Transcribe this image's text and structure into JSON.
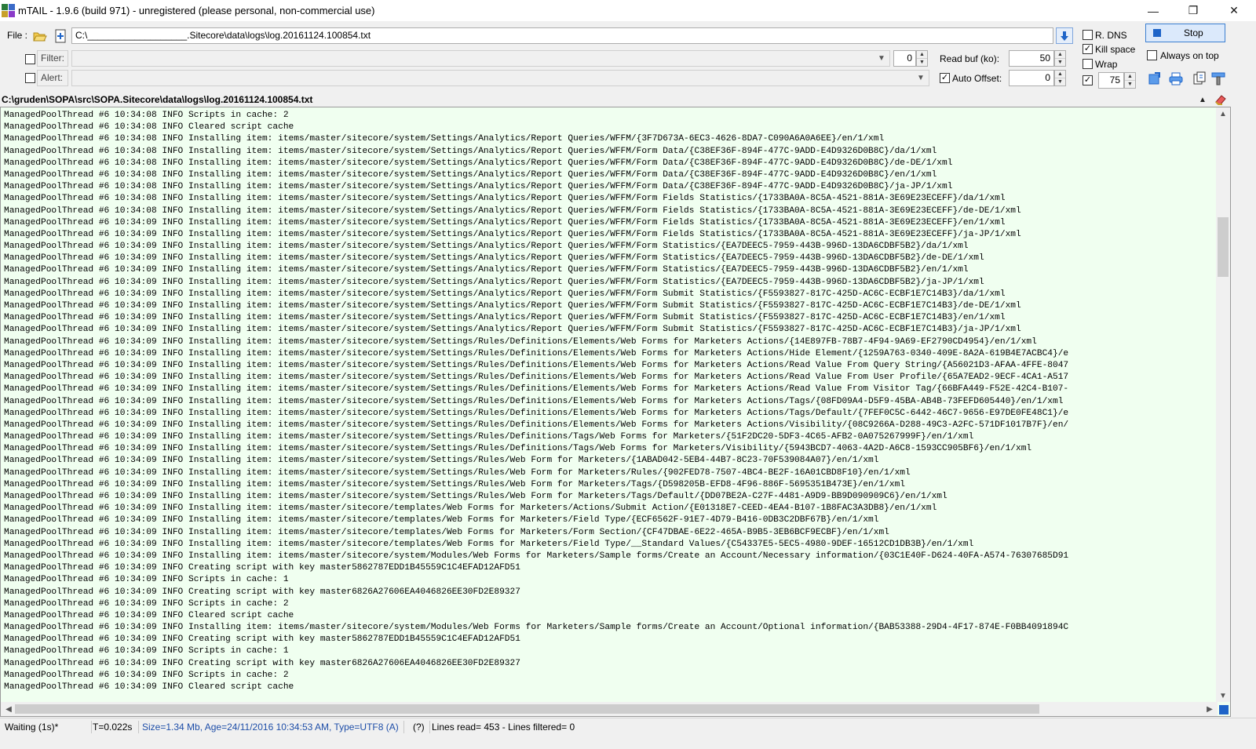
{
  "window": {
    "title": "mTAIL - 1.9.6 (build 971) - unregistered (please personal, non-commercial use)",
    "controls": [
      "—",
      "❐",
      "✕"
    ]
  },
  "toolbar": {
    "file_label": "File :",
    "file_path": "C:\\___________________.Sitecore\\data\\logs\\log.20161124.100854.txt",
    "filter_label": "Filter:",
    "filter_value": "",
    "filter_spin": "0",
    "alert_label": "Alert:",
    "alert_value": "",
    "read_buf_label": "Read buf (ko):",
    "read_buf_value": "50",
    "auto_offset_label": "Auto Offset:",
    "auto_offset_value": "0",
    "auto_offset_checked": true,
    "option_r_dns": "R. DNS",
    "option_kill_space": "Kill space",
    "option_wrap": "Wrap",
    "spin_75_value": "75",
    "stop_label": "Stop",
    "always_on_top": "Always on top",
    "icons": [
      "open-folder-icon",
      "add-file-icon",
      "download-arrow-icon",
      "export-icon",
      "print-icon",
      "copy-icon",
      "tools-icon",
      "collapse-icon",
      "eraser-icon"
    ]
  },
  "log": {
    "path": "C:\\gruden\\SOPA\\src\\SOPA.Sitecore\\data\\logs\\log.20161124.100854.txt",
    "lines": [
      "ManagedPoolThread #6 10:34:08 INFO Scripts in cache: 2",
      "ManagedPoolThread #6 10:34:08 INFO Cleared script cache",
      "ManagedPoolThread #6 10:34:08 INFO Installing item: items/master/sitecore/system/Settings/Analytics/Report Queries/WFFM/{3F7D673A-6EC3-4626-8DA7-C090A6A0A6EE}/en/1/xml",
      "ManagedPoolThread #6 10:34:08 INFO Installing item: items/master/sitecore/system/Settings/Analytics/Report Queries/WFFM/Form Data/{C38EF36F-894F-477C-9ADD-E4D9326D0B8C}/da/1/xml",
      "ManagedPoolThread #6 10:34:08 INFO Installing item: items/master/sitecore/system/Settings/Analytics/Report Queries/WFFM/Form Data/{C38EF36F-894F-477C-9ADD-E4D9326D0B8C}/de-DE/1/xml",
      "ManagedPoolThread #6 10:34:08 INFO Installing item: items/master/sitecore/system/Settings/Analytics/Report Queries/WFFM/Form Data/{C38EF36F-894F-477C-9ADD-E4D9326D0B8C}/en/1/xml",
      "ManagedPoolThread #6 10:34:08 INFO Installing item: items/master/sitecore/system/Settings/Analytics/Report Queries/WFFM/Form Data/{C38EF36F-894F-477C-9ADD-E4D9326D0B8C}/ja-JP/1/xml",
      "ManagedPoolThread #6 10:34:08 INFO Installing item: items/master/sitecore/system/Settings/Analytics/Report Queries/WFFM/Form Fields Statistics/{1733BA0A-8C5A-4521-881A-3E69E23ECEFF}/da/1/xml",
      "ManagedPoolThread #6 10:34:08 INFO Installing item: items/master/sitecore/system/Settings/Analytics/Report Queries/WFFM/Form Fields Statistics/{1733BA0A-8C5A-4521-881A-3E69E23ECEFF}/de-DE/1/xml",
      "ManagedPoolThread #6 10:34:09 INFO Installing item: items/master/sitecore/system/Settings/Analytics/Report Queries/WFFM/Form Fields Statistics/{1733BA0A-8C5A-4521-881A-3E69E23ECEFF}/en/1/xml",
      "ManagedPoolThread #6 10:34:09 INFO Installing item: items/master/sitecore/system/Settings/Analytics/Report Queries/WFFM/Form Fields Statistics/{1733BA0A-8C5A-4521-881A-3E69E23ECEFF}/ja-JP/1/xml",
      "ManagedPoolThread #6 10:34:09 INFO Installing item: items/master/sitecore/system/Settings/Analytics/Report Queries/WFFM/Form Statistics/{EA7DEEC5-7959-443B-996D-13DA6CDBF5B2}/da/1/xml",
      "ManagedPoolThread #6 10:34:09 INFO Installing item: items/master/sitecore/system/Settings/Analytics/Report Queries/WFFM/Form Statistics/{EA7DEEC5-7959-443B-996D-13DA6CDBF5B2}/de-DE/1/xml",
      "ManagedPoolThread #6 10:34:09 INFO Installing item: items/master/sitecore/system/Settings/Analytics/Report Queries/WFFM/Form Statistics/{EA7DEEC5-7959-443B-996D-13DA6CDBF5B2}/en/1/xml",
      "ManagedPoolThread #6 10:34:09 INFO Installing item: items/master/sitecore/system/Settings/Analytics/Report Queries/WFFM/Form Statistics/{EA7DEEC5-7959-443B-996D-13DA6CDBF5B2}/ja-JP/1/xml",
      "ManagedPoolThread #6 10:34:09 INFO Installing item: items/master/sitecore/system/Settings/Analytics/Report Queries/WFFM/Form Submit Statistics/{F5593827-817C-425D-AC6C-ECBF1E7C14B3}/da/1/xml",
      "ManagedPoolThread #6 10:34:09 INFO Installing item: items/master/sitecore/system/Settings/Analytics/Report Queries/WFFM/Form Submit Statistics/{F5593827-817C-425D-AC6C-ECBF1E7C14B3}/de-DE/1/xml",
      "ManagedPoolThread #6 10:34:09 INFO Installing item: items/master/sitecore/system/Settings/Analytics/Report Queries/WFFM/Form Submit Statistics/{F5593827-817C-425D-AC6C-ECBF1E7C14B3}/en/1/xml",
      "ManagedPoolThread #6 10:34:09 INFO Installing item: items/master/sitecore/system/Settings/Analytics/Report Queries/WFFM/Form Submit Statistics/{F5593827-817C-425D-AC6C-ECBF1E7C14B3}/ja-JP/1/xml",
      "ManagedPoolThread #6 10:34:09 INFO Installing item: items/master/sitecore/system/Settings/Rules/Definitions/Elements/Web Forms for Marketers Actions/{14E897FB-78B7-4F94-9A69-EF2790CD4954}/en/1/xml",
      "ManagedPoolThread #6 10:34:09 INFO Installing item: items/master/sitecore/system/Settings/Rules/Definitions/Elements/Web Forms for Marketers Actions/Hide Element/{1259A763-0340-409E-8A2A-619B4E7ACBC4}/e",
      "ManagedPoolThread #6 10:34:09 INFO Installing item: items/master/sitecore/system/Settings/Rules/Definitions/Elements/Web Forms for Marketers Actions/Read Value From Query String/{A56021D3-AFAA-4FFE-8047",
      "ManagedPoolThread #6 10:34:09 INFO Installing item: items/master/sitecore/system/Settings/Rules/Definitions/Elements/Web Forms for Marketers Actions/Read Value From User Profile/{65A7EAD2-9ECF-4CA1-A517",
      "ManagedPoolThread #6 10:34:09 INFO Installing item: items/master/sitecore/system/Settings/Rules/Definitions/Elements/Web Forms for Marketers Actions/Read Value From Visitor Tag/{66BFA449-F52E-42C4-B107-",
      "ManagedPoolThread #6 10:34:09 INFO Installing item: items/master/sitecore/system/Settings/Rules/Definitions/Elements/Web Forms for Marketers Actions/Tags/{08FD09A4-D5F9-45BA-AB4B-73FEFD605440}/en/1/xml",
      "ManagedPoolThread #6 10:34:09 INFO Installing item: items/master/sitecore/system/Settings/Rules/Definitions/Elements/Web Forms for Marketers Actions/Tags/Default/{7FEF0C5C-6442-46C7-9656-E97DE0FE48C1}/e",
      "ManagedPoolThread #6 10:34:09 INFO Installing item: items/master/sitecore/system/Settings/Rules/Definitions/Elements/Web Forms for Marketers Actions/Visibility/{08C9266A-D288-49C3-A2FC-571DF1017B7F}/en/",
      "ManagedPoolThread #6 10:34:09 INFO Installing item: items/master/sitecore/system/Settings/Rules/Definitions/Tags/Web Forms for Marketers/{51F2DC20-5DF3-4C65-AFB2-0A075267999F}/en/1/xml",
      "ManagedPoolThread #6 10:34:09 INFO Installing item: items/master/sitecore/system/Settings/Rules/Definitions/Tags/Web Forms for Marketers/Visibility/{5943BCD7-4063-4A2D-A6C8-1593CC905BF6}/en/1/xml",
      "ManagedPoolThread #6 10:34:09 INFO Installing item: items/master/sitecore/system/Settings/Rules/Web Form for Marketers/{1ABAD042-5EB4-44B7-8C23-70F539084A07}/en/1/xml",
      "ManagedPoolThread #6 10:34:09 INFO Installing item: items/master/sitecore/system/Settings/Rules/Web Form for Marketers/Rules/{902FED78-7507-4BC4-BE2F-16A01CBD8F10}/en/1/xml",
      "ManagedPoolThread #6 10:34:09 INFO Installing item: items/master/sitecore/system/Settings/Rules/Web Form for Marketers/Tags/{D598205B-EFD8-4F96-886F-5695351B473E}/en/1/xml",
      "ManagedPoolThread #6 10:34:09 INFO Installing item: items/master/sitecore/system/Settings/Rules/Web Form for Marketers/Tags/Default/{DD07BE2A-C27F-4481-A9D9-BB9D090909C6}/en/1/xml",
      "ManagedPoolThread #6 10:34:09 INFO Installing item: items/master/sitecore/templates/Web Forms for Marketers/Actions/Submit Action/{E01318E7-CEED-4EA4-B107-1B8FAC3A3DB8}/en/1/xml",
      "ManagedPoolThread #6 10:34:09 INFO Installing item: items/master/sitecore/templates/Web Forms for Marketers/Field Type/{ECF6562F-91E7-4D79-B416-0DB3C2DBF67B}/en/1/xml",
      "ManagedPoolThread #6 10:34:09 INFO Installing item: items/master/sitecore/templates/Web Forms for Marketers/Form Section/{CF47DBAE-6E22-465A-B9B5-3EB6BCF9ECBF}/en/1/xml",
      "ManagedPoolThread #6 10:34:09 INFO Installing item: items/master/sitecore/templates/Web Forms for Marketers/Field Type/__Standard Values/{C54337E5-5EC5-4980-9DEF-16512CD1DB3B}/en/1/xml",
      "ManagedPoolThread #6 10:34:09 INFO Installing item: items/master/sitecore/system/Modules/Web Forms for Marketers/Sample forms/Create an Account/Necessary information/{03C1E40F-D624-40FA-A574-76307685D91",
      "ManagedPoolThread #6 10:34:09 INFO Creating script with key master5862787EDD1B45559C1C4EFAD12AFD51",
      "ManagedPoolThread #6 10:34:09 INFO Scripts in cache: 1",
      "ManagedPoolThread #6 10:34:09 INFO Creating script with key master6826A27606EA4046826EE30FD2E89327",
      "ManagedPoolThread #6 10:34:09 INFO Scripts in cache: 2",
      "ManagedPoolThread #6 10:34:09 INFO Cleared script cache",
      "ManagedPoolThread #6 10:34:09 INFO Installing item: items/master/sitecore/system/Modules/Web Forms for Marketers/Sample forms/Create an Account/Optional information/{BAB53388-29D4-4F17-874E-F0BB4091894C",
      "ManagedPoolThread #6 10:34:09 INFO Creating script with key master5862787EDD1B45559C1C4EFAD12AFD51",
      "ManagedPoolThread #6 10:34:09 INFO Scripts in cache: 1",
      "ManagedPoolThread #6 10:34:09 INFO Creating script with key master6826A27606EA4046826EE30FD2E89327",
      "ManagedPoolThread #6 10:34:09 INFO Scripts in cache: 2",
      "ManagedPoolThread #6 10:34:09 INFO Cleared script cache"
    ]
  },
  "status": {
    "state": "Waiting (1s)*",
    "time": "T=0.022s",
    "file_info": "Size=1.34 Mb, Age=24/11/2016 10:34:53 AM, Type=UTF8 (A)",
    "help": "(?)",
    "lines_info": "Lines read= 453 - Lines filtered= 0"
  },
  "colors": {
    "log_background": "#f0fff0",
    "accent_blue": "#1e64c8",
    "stop_button_bg": "#dbe9fb"
  }
}
